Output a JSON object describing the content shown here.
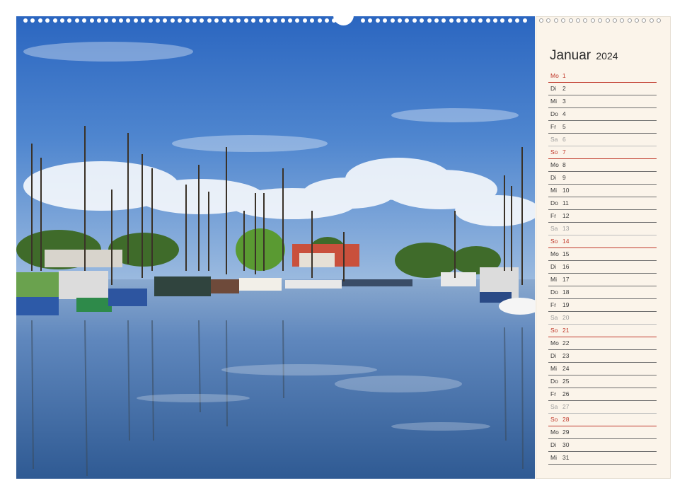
{
  "calendar": {
    "month": "Januar",
    "year": "2024",
    "days": [
      {
        "weekday": "Mo",
        "day": "1",
        "type": "holiday"
      },
      {
        "weekday": "Di",
        "day": "2",
        "type": "weekday"
      },
      {
        "weekday": "Mi",
        "day": "3",
        "type": "weekday"
      },
      {
        "weekday": "Do",
        "day": "4",
        "type": "weekday"
      },
      {
        "weekday": "Fr",
        "day": "5",
        "type": "weekday"
      },
      {
        "weekday": "Sa",
        "day": "6",
        "type": "saturday"
      },
      {
        "weekday": "So",
        "day": "7",
        "type": "sunday"
      },
      {
        "weekday": "Mo",
        "day": "8",
        "type": "weekday"
      },
      {
        "weekday": "Di",
        "day": "9",
        "type": "weekday"
      },
      {
        "weekday": "Mi",
        "day": "10",
        "type": "weekday"
      },
      {
        "weekday": "Do",
        "day": "11",
        "type": "weekday"
      },
      {
        "weekday": "Fr",
        "day": "12",
        "type": "weekday"
      },
      {
        "weekday": "Sa",
        "day": "13",
        "type": "saturday"
      },
      {
        "weekday": "So",
        "day": "14",
        "type": "sunday"
      },
      {
        "weekday": "Mo",
        "day": "15",
        "type": "weekday"
      },
      {
        "weekday": "Di",
        "day": "16",
        "type": "weekday"
      },
      {
        "weekday": "Mi",
        "day": "17",
        "type": "weekday"
      },
      {
        "weekday": "Do",
        "day": "18",
        "type": "weekday"
      },
      {
        "weekday": "Fr",
        "day": "19",
        "type": "weekday"
      },
      {
        "weekday": "Sa",
        "day": "20",
        "type": "saturday"
      },
      {
        "weekday": "So",
        "day": "21",
        "type": "sunday"
      },
      {
        "weekday": "Mo",
        "day": "22",
        "type": "weekday"
      },
      {
        "weekday": "Di",
        "day": "23",
        "type": "weekday"
      },
      {
        "weekday": "Mi",
        "day": "24",
        "type": "weekday"
      },
      {
        "weekday": "Do",
        "day": "25",
        "type": "weekday"
      },
      {
        "weekday": "Fr",
        "day": "26",
        "type": "weekday"
      },
      {
        "weekday": "Sa",
        "day": "27",
        "type": "saturday"
      },
      {
        "weekday": "So",
        "day": "28",
        "type": "sunday"
      },
      {
        "weekday": "Mo",
        "day": "29",
        "type": "weekday"
      },
      {
        "weekday": "Di",
        "day": "30",
        "type": "weekday"
      },
      {
        "weekday": "Mi",
        "day": "31",
        "type": "weekday"
      }
    ]
  },
  "colors": {
    "sunday_red": "#c0392b",
    "saturday_grey": "#9a9a9a",
    "panel_background": "#fbf4ea",
    "sky_blue": "#2f6fc4",
    "water_blue": "#4a78b0"
  }
}
